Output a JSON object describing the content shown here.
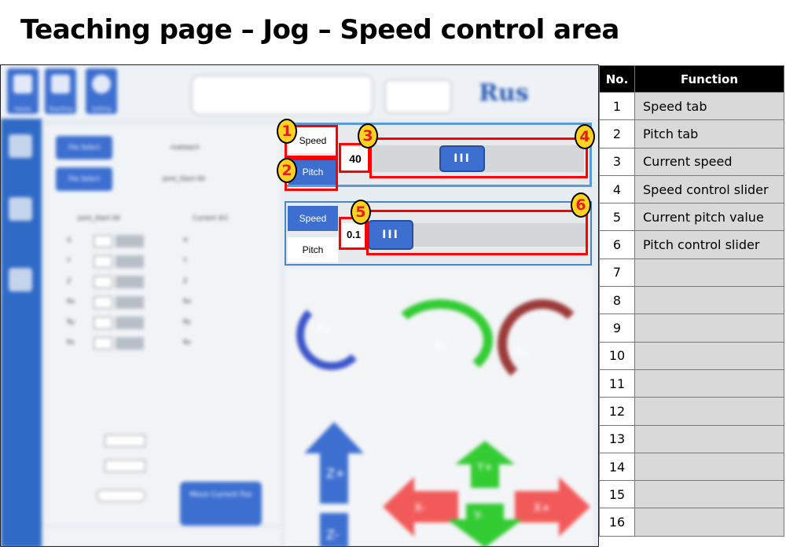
{
  "title": "Teaching page – Jog – Speed control area",
  "colors": {
    "accent_blue": "#3d6fd1",
    "highlight_red": "#ff0000",
    "badge_yellow": "#ffd21f",
    "panel_border": "#5b9bd5"
  },
  "background_ui": {
    "top_tabs": [
      "Home",
      "Teaching",
      "Setting"
    ],
    "logo": "Rus",
    "file_buttons": [
      "File Select",
      "File Select"
    ],
    "file_names": [
      "rowteach",
      "Joint_Start 00"
    ],
    "column_headers": [
      "Joint_Start 00",
      "Current 4/1"
    ],
    "axis_labels": [
      "X",
      "Y",
      "Z",
      "Rx",
      "Ry",
      "Rz"
    ],
    "move_button": "Move Current Pos",
    "jog_labels": {
      "rz": "Rz",
      "ry": "Ry",
      "rx": "Rx",
      "zplus": "Z+",
      "zminus": "Z-",
      "xminus": "X-",
      "xplus": "X+",
      "yplus": "Y+",
      "yminus": "Y-"
    }
  },
  "speed_panel": {
    "speed_tab": "Speed",
    "pitch_tab": "Pitch",
    "current_speed": "40",
    "speed_fraction": 0.4,
    "thumb_glyph": "III"
  },
  "pitch_panel": {
    "speed_tab": "Speed",
    "pitch_tab": "Pitch",
    "current_pitch": "0.1",
    "pitch_fraction": 0.0,
    "thumb_glyph": "III"
  },
  "badges": [
    "1",
    "2",
    "3",
    "4",
    "5",
    "6"
  ],
  "function_table": {
    "headers": [
      "No.",
      "Function"
    ],
    "rows": [
      {
        "no": "1",
        "fn": "Speed tab"
      },
      {
        "no": "2",
        "fn": "Pitch tab"
      },
      {
        "no": "3",
        "fn": "Current speed"
      },
      {
        "no": "4",
        "fn": "Speed control slider"
      },
      {
        "no": "5",
        "fn": "Current pitch value"
      },
      {
        "no": "6",
        "fn": "Pitch control slider"
      },
      {
        "no": "7",
        "fn": ""
      },
      {
        "no": "8",
        "fn": ""
      },
      {
        "no": "9",
        "fn": ""
      },
      {
        "no": "10",
        "fn": ""
      },
      {
        "no": "11",
        "fn": ""
      },
      {
        "no": "12",
        "fn": ""
      },
      {
        "no": "13",
        "fn": ""
      },
      {
        "no": "14",
        "fn": ""
      },
      {
        "no": "15",
        "fn": ""
      },
      {
        "no": "16",
        "fn": ""
      }
    ]
  }
}
